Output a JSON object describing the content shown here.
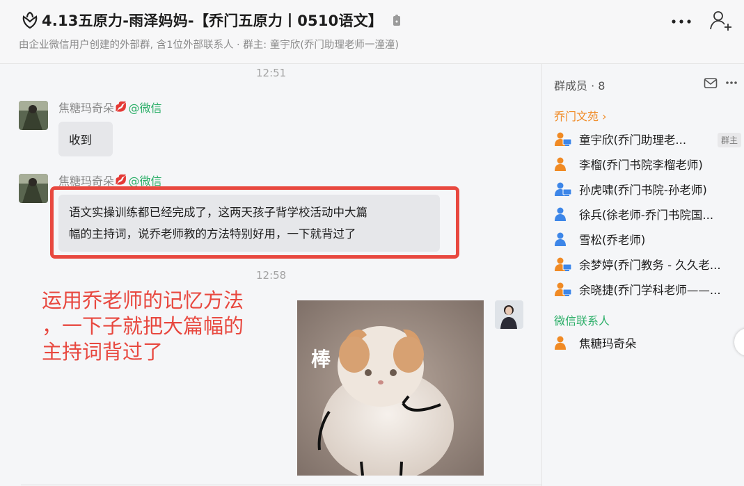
{
  "header": {
    "title": "4.13五原力-雨泽妈妈-【乔门五原力丨0510语文】",
    "subtitle": "由企业微信用户创建的外部群, 含1位外部联系人 · 群主: 童宇欣(乔门助理老师一潼潼)",
    "icons": [
      "group-flower-icon",
      "lock-icon",
      "more-icon",
      "add-member-icon"
    ]
  },
  "chat": {
    "time1": "12:51",
    "time2": "12:58",
    "messages": [
      {
        "sender": "焦糖玛奇朵",
        "source": "@微信",
        "text": "收到"
      },
      {
        "sender": "焦糖玛奇朵",
        "source": "@微信",
        "line1": "语文实操训练都已经完成了，这两天孩子背学校活动中大篇",
        "line2": "幅的主持词，说乔老师教的方法特别好用，一下就背过了"
      }
    ],
    "annotation": {
      "line1": "运用乔老师的记忆方法",
      "line2": "，一下子就把大篇幅的",
      "line3": "主持词背过了"
    },
    "sticker_text": "棒",
    "highlight_color": "#e8483f"
  },
  "members": {
    "header": "群成员 · 8",
    "section_company": "乔门文苑",
    "section_company_arrow": "›",
    "owner_badge": "群主",
    "company_members": [
      {
        "name": "童宇欣(乔门助理老...",
        "icon": "person-computer-icon",
        "color": "#f08a24"
      },
      {
        "name": "李榴(乔门书院李榴老师)",
        "icon": "person-icon",
        "color": "#f08a24"
      },
      {
        "name": "孙虎啸(乔门书院-孙老师)",
        "icon": "person-computer-icon",
        "color": "#3d86e8"
      },
      {
        "name": "徐兵(徐老师-乔门书院国...",
        "icon": "person-icon",
        "color": "#3d86e8"
      },
      {
        "name": "雪松(乔老师)",
        "icon": "person-icon",
        "color": "#3d86e8"
      },
      {
        "name": "余梦婷(乔门教务 - 久久老...",
        "icon": "person-computer-icon",
        "color": "#f08a24"
      },
      {
        "name": "余晓捷(乔门学科老师——...",
        "icon": "person-computer-icon",
        "color": "#f08a24"
      }
    ],
    "section_wechat": "微信联系人",
    "wechat_members": [
      {
        "name": "焦糖玛奇朵",
        "icon": "person-icon",
        "color": "#f08a24"
      }
    ],
    "orange": "#f08a24",
    "green": "#2aae67"
  }
}
